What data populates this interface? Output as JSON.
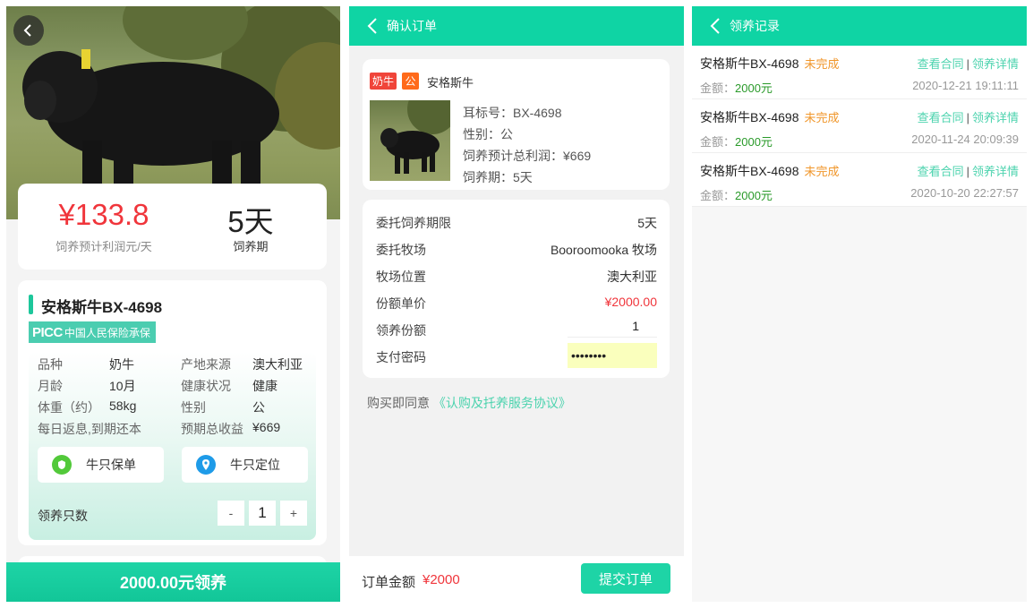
{
  "detail": {
    "price": "¥133.8",
    "price_label": "饲养预计利润元/天",
    "period": "5天",
    "period_label": "饲养期",
    "title": "安格斯牛BX-4698",
    "insurance_logo": "PICC",
    "insurance_text": "中国人民保险承保",
    "specs": [
      {
        "k1": "品种",
        "v1": "奶牛",
        "k2": "产地来源",
        "v2": "澳大利亚"
      },
      {
        "k1": "月龄",
        "v1": "10月",
        "k2": "健康状况",
        "v2": "健康"
      },
      {
        "k1": "体重（约）",
        "v1": "58kg",
        "k2": "性别",
        "v2": "公"
      },
      {
        "k1": "每日返息,到期还本",
        "v1": "",
        "k2": "预期总收益",
        "v2": "¥669"
      }
    ],
    "policy_button": "牛只保单",
    "locate_button": "牛只定位",
    "qty_label": "领养只数",
    "qty_minus": "-",
    "qty_value": "1",
    "qty_plus": "+",
    "adopt_button": "2000.00元领养"
  },
  "order": {
    "nav_title": "确认订单",
    "tag_type": "奶牛",
    "tag_gender": "公",
    "product_name": "安格斯牛",
    "ear_tag": "耳标号：BX-4698",
    "gender": "性别：公",
    "profit": "饲养预计总利润：¥669",
    "period": "饲养期：5天",
    "rows": [
      {
        "label": "委托饲养期限",
        "value": "5天"
      },
      {
        "label": "委托牧场",
        "value": "Booroomooka 牧场"
      },
      {
        "label": "牧场位置",
        "value": "澳大利亚"
      },
      {
        "label": "份额单价",
        "value": "¥2000.00"
      }
    ],
    "qty_label": "领养份额",
    "qty_value": "1",
    "pwd_label": "支付密码",
    "pwd_value": "••••••••",
    "agree_text": "购买即同意",
    "agree_link": "《认购及托养服务协议》",
    "total_label": "订单金额",
    "total_value": "¥2000",
    "submit": "提交订单"
  },
  "records": {
    "nav_title": "领养记录",
    "items": [
      {
        "name": "安格斯牛BX-4698",
        "status": "未完成",
        "contract": "查看合同",
        "detail": "领养详情",
        "amount_label": "金额：",
        "amount": "2000元",
        "time": "2020-12-21 19:11:11"
      },
      {
        "name": "安格斯牛BX-4698",
        "status": "未完成",
        "contract": "查看合同",
        "detail": "领养详情",
        "amount_label": "金额：",
        "amount": "2000元",
        "time": "2020-11-24 20:09:39"
      },
      {
        "name": "安格斯牛BX-4698",
        "status": "未完成",
        "contract": "查看合同",
        "detail": "领养详情",
        "amount_label": "金额：",
        "amount": "2000元",
        "time": "2020-10-20 22:27:57"
      }
    ],
    "separator": "|"
  },
  "colors": {
    "accent": "#0fd4a4",
    "price_red": "#f0353b",
    "status_orange": "#f0962a",
    "amount_green": "#2a9a2a"
  },
  "icons": [
    "back-arrow-icon",
    "policy-shield-icon",
    "location-pin-icon",
    "picc-logo-icon"
  ]
}
